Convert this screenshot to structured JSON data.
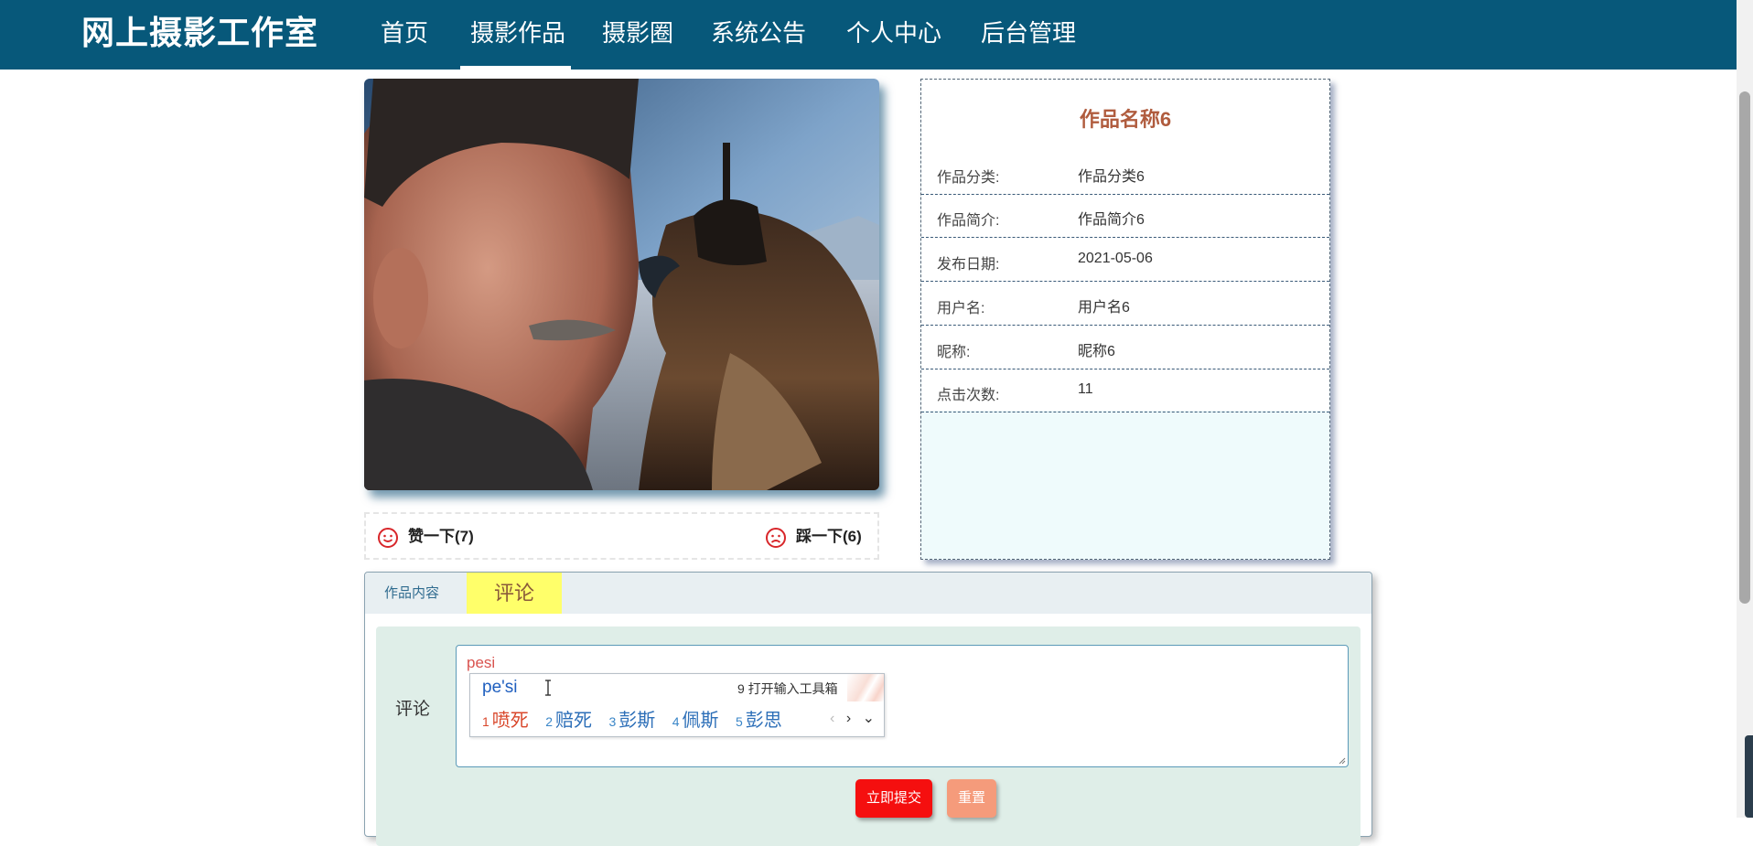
{
  "header": {
    "brand": "网上摄影工作室",
    "nav": [
      "首页",
      "摄影作品",
      "摄影圈",
      "系统公告",
      "个人中心",
      "后台管理"
    ],
    "active_index": 1
  },
  "work": {
    "title": "作品名称6",
    "fields": [
      {
        "label": "作品分类:",
        "value": "作品分类6"
      },
      {
        "label": "作品简介:",
        "value": "作品简介6"
      },
      {
        "label": "发布日期:",
        "value": "2021-05-06"
      },
      {
        "label": "用户名:",
        "value": "用户名6"
      },
      {
        "label": "昵称:",
        "value": "昵称6"
      },
      {
        "label": "点击次数:",
        "value": "11"
      }
    ]
  },
  "votes": {
    "like_label": "赞一下(7)",
    "dislike_label": "踩一下(6)"
  },
  "tabs": {
    "content_label": "作品内容",
    "comment_label": "评论"
  },
  "form": {
    "label": "评论",
    "typed_text": "pesi",
    "submit_label": "立即提交",
    "reset_label": "重置"
  },
  "ime": {
    "pinyin": "pe'si",
    "toolbox": "9 打开输入工具箱",
    "candidates": [
      {
        "num": "1",
        "word": "喷死"
      },
      {
        "num": "2",
        "word": "赔死"
      },
      {
        "num": "3",
        "word": "彭斯"
      },
      {
        "num": "4",
        "word": "佩斯"
      },
      {
        "num": "5",
        "word": "彭思"
      }
    ],
    "prev": "‹",
    "next": "›",
    "expand": "⌄"
  },
  "colors": {
    "header_bg": "#07587a",
    "title_color": "#b05c3e",
    "submit_bg": "#f50f0f",
    "reset_bg": "#f59b7b",
    "comment_tab_bg": "#ffff6a",
    "panel_bg": "#effbfc",
    "form_bg": "#dfeee8"
  },
  "icons": [
    "smile-icon",
    "frown-icon",
    "text-cursor-icon",
    "resize-grip-icon"
  ]
}
